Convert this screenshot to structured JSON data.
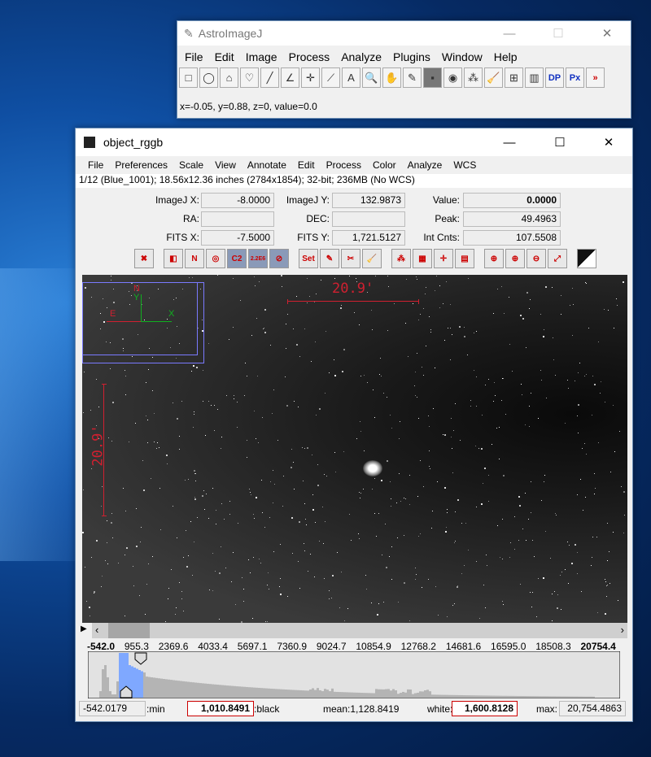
{
  "main_window": {
    "title": "AstroImageJ",
    "menu": [
      "File",
      "Edit",
      "Image",
      "Process",
      "Analyze",
      "Plugins",
      "Window",
      "Help"
    ],
    "tools": [
      "rectangle-icon",
      "oval-icon",
      "polygon-icon",
      "freehand-icon",
      "line-icon",
      "angle-icon",
      "point-icon",
      "wand-icon",
      "text-icon",
      "magnifier-icon",
      "hand-icon",
      "dropper-icon",
      "astro-tool-icon",
      "aperture-icon",
      "multi-aperture-icon",
      "broom-icon",
      "plot-icon",
      "table-icon",
      "dp-icon",
      "px-icon",
      "more-icon"
    ],
    "tool_glyphs": [
      "□",
      "◯",
      "⌂",
      "♡",
      "╱",
      "∠",
      "✛",
      "⟋",
      "A",
      "🔍",
      "✋",
      "✎",
      "▪",
      "◉",
      "⁂",
      "🧹",
      "⊞",
      "▥",
      "DP",
      "Px",
      "»"
    ],
    "status": "x=-0.05, y=0.88, z=0, value=0.0"
  },
  "image_window": {
    "title": "object_rggb",
    "menu": [
      "File",
      "Preferences",
      "Scale",
      "View",
      "Annotate",
      "Edit",
      "Process",
      "Color",
      "Analyze",
      "WCS"
    ],
    "info": "1/12 (Blue_1001); 18.56x12.36 inches (2784x1854); 32-bit; 236MB (No WCS)",
    "fields": {
      "imagej_x_label": "ImageJ X:",
      "imagej_x": "-8.0000",
      "imagej_y_label": "ImageJ Y:",
      "imagej_y": "132.9873",
      "value_label": "Value:",
      "value": "0.0000",
      "ra_label": "RA:",
      "ra": "",
      "dec_label": "DEC:",
      "dec": "",
      "peak_label": "Peak:",
      "peak": "49.4963",
      "fits_x_label": "FITS X:",
      "fits_x": "-7.5000",
      "fits_y_label": "FITS Y:",
      "fits_y": "1,721.5127",
      "int_cnts_label": "Int Cnts:",
      "int_cnts": "107.5508"
    },
    "icons": [
      "clear-overlay-icon",
      "invert-icon",
      "name-icon",
      "aperture-ring-icon",
      "c2-icon",
      "scale-icon",
      "no-aperture-icon",
      "set-aperture-icon",
      "edit-aperture-icon",
      "clear-apertures-icon",
      "broom-icon",
      "multi-aperture-icon",
      "measure-icon",
      "align-icon",
      "table-icon",
      "zoom-in-icon",
      "zoom-in-plus-icon",
      "zoom-out-icon",
      "zoom-fit-icon",
      "contrast-icon"
    ],
    "icon_glyphs": [
      "✖",
      "◧",
      "N",
      "◎",
      "C2",
      "2.2E6",
      "⊘",
      "Set",
      "✎",
      "✂",
      "🧹",
      "⁂",
      "▦",
      "✛",
      "▤",
      "⊕",
      "⊕",
      "⊖",
      "⤢",
      "◩"
    ],
    "overlay": {
      "scale_top": "20.9'",
      "scale_left": "20.9'",
      "north": "N",
      "east": "E",
      "x_axis": "X",
      "y_axis": "Y"
    },
    "histogram": {
      "ticks": [
        "-542.0",
        "955.3",
        "2369.6",
        "4033.4",
        "5697.1",
        "7360.9",
        "9024.7",
        "10854.9",
        "12768.2",
        "14681.6",
        "16595.0",
        "18508.3",
        "20754.4"
      ],
      "min": "-542.0179",
      "min_label": ":min",
      "black": "1,010.8491",
      "black_label": ":black",
      "mean_label": "mean:",
      "mean": "1,128.8419",
      "white_label": "white:",
      "white": "1,600.8128",
      "max_label": "max:",
      "max": "20,754.4863",
      "highlight_color": "#7fa8ff"
    }
  }
}
